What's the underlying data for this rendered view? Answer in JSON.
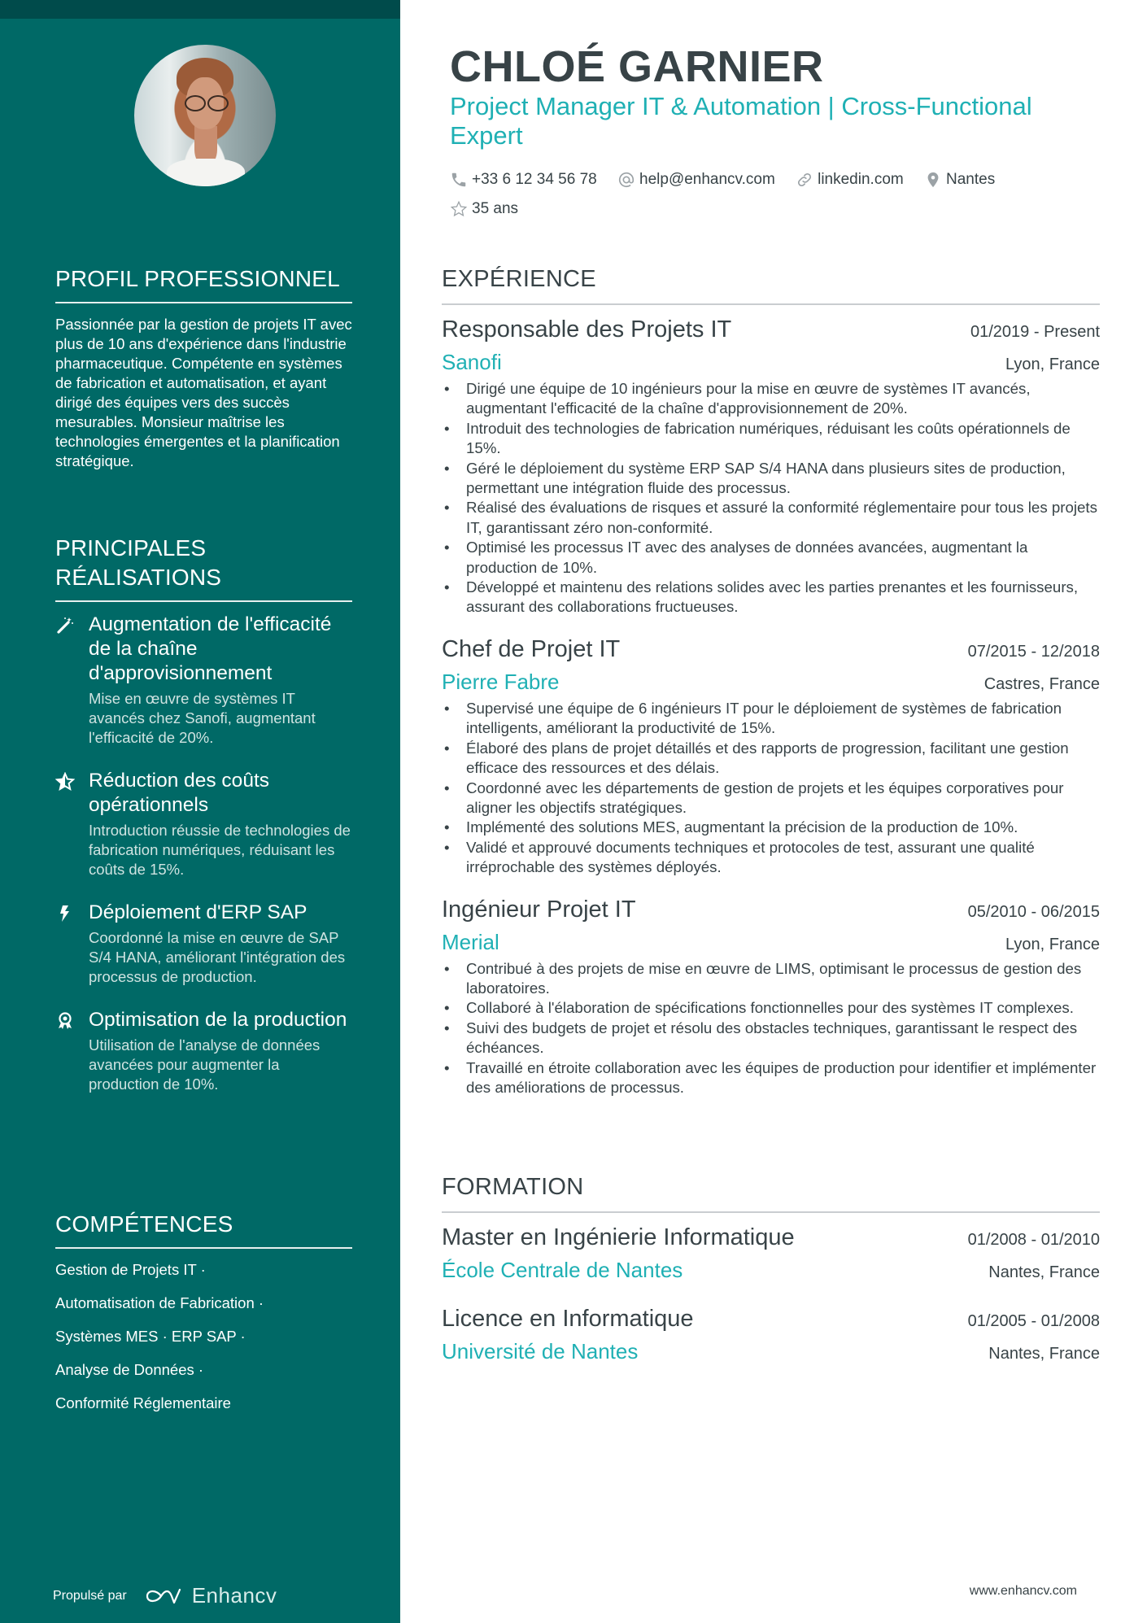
{
  "header": {
    "name": "CHLOÉ GARNIER",
    "tagline": "Project Manager IT & Automation | Cross-Functional Expert",
    "contacts": [
      {
        "icon": "phone-icon",
        "text": "+33 6 12 34 56 78"
      },
      {
        "icon": "at-icon",
        "text": "help@enhancv.com"
      },
      {
        "icon": "link-icon",
        "text": "linkedin.com"
      },
      {
        "icon": "location-pin-icon",
        "text": "Nantes"
      },
      {
        "icon": "star-outline-icon",
        "text": "35 ans"
      }
    ]
  },
  "sidebar": {
    "profile": {
      "title": "PROFIL PROFESSIONNEL",
      "text": "Passionnée par la gestion de projets IT avec plus de 10 ans d'expérience dans l'industrie pharmaceutique. Compétente en systèmes de fabrication et automatisation, et ayant dirigé des équipes vers des succès mesurables. Monsieur maîtrise les technologies émergentes et la planification stratégique."
    },
    "achievements": {
      "title": "PRINCIPALES RÉALISATIONS",
      "items": [
        {
          "icon": "magic-wand-icon",
          "title": "Augmentation de l'efficacité de la chaîne d'approvisionnement",
          "description": "Mise en œuvre de systèmes IT avancés chez Sanofi, augmentant l'efficacité de 20%."
        },
        {
          "icon": "star-half-icon",
          "title": "Réduction des coûts opérationnels",
          "description": "Introduction réussie de technologies de fabrication numériques, réduisant les coûts de 15%."
        },
        {
          "icon": "lightning-icon",
          "title": "Déploiement d'ERP SAP",
          "description": "Coordonné la mise en œuvre de SAP S/4 HANA, améliorant l'intégration des processus de production."
        },
        {
          "icon": "award-medal-icon",
          "title": "Optimisation de la production",
          "description": "Utilisation de l'analyse de données avancées pour augmenter la production de 10%."
        }
      ]
    },
    "skills": {
      "title": "COMPÉTENCES",
      "lines": [
        "Gestion de Projets IT ·",
        "Automatisation de Fabrication ·",
        "Systèmes MES · ERP SAP ·",
        "Analyse de Données ·",
        "Conformité Réglementaire"
      ]
    },
    "footer": {
      "powered_by": "Propulsé par",
      "brand": "Enhancv"
    }
  },
  "experience": {
    "title": "EXPÉRIENCE",
    "jobs": [
      {
        "title": "Responsable des Projets IT",
        "dates": "01/2019 - Present",
        "company": "Sanofi",
        "location": "Lyon, France",
        "bullets": [
          "Dirigé une équipe de 10 ingénieurs pour la mise en œuvre de systèmes IT avancés, augmentant l'efficacité de la chaîne d'approvisionnement de 20%.",
          "Introduit des technologies de fabrication numériques, réduisant les coûts opérationnels de 15%.",
          "Géré le déploiement du système ERP SAP S/4 HANA dans plusieurs sites de production, permettant une intégration fluide des processus.",
          "Réalisé des évaluations de risques et assuré la conformité réglementaire pour tous les projets IT, garantissant zéro non-conformité.",
          "Optimisé les processus IT avec des analyses de données avancées, augmentant la production de 10%.",
          "Développé et maintenu des relations solides avec les parties prenantes et les fournisseurs, assurant des collaborations fructueuses."
        ]
      },
      {
        "title": "Chef de Projet IT",
        "dates": "07/2015 - 12/2018",
        "company": "Pierre Fabre",
        "location": "Castres, France",
        "bullets": [
          "Supervisé une équipe de 6 ingénieurs IT pour le déploiement de systèmes de fabrication intelligents, améliorant la productivité de 15%.",
          "Élaboré des plans de projet détaillés et des rapports de progression, facilitant une gestion efficace des ressources et des délais.",
          "Coordonné avec les départements de gestion de projets et les équipes corporatives pour aligner les objectifs stratégiques.",
          "Implémenté des solutions MES, augmentant la précision de la production de 10%.",
          "Validé et approuvé documents techniques et protocoles de test, assurant une qualité irréprochable des systèmes déployés."
        ]
      },
      {
        "title": "Ingénieur Projet IT",
        "dates": "05/2010 - 06/2015",
        "company": "Merial",
        "location": "Lyon, France",
        "bullets": [
          "Contribué à des projets de mise en œuvre de LIMS, optimisant le processus de gestion des laboratoires.",
          "Collaboré à l'élaboration de spécifications fonctionnelles pour des systèmes IT complexes.",
          "Suivi des budgets de projet et résolu des obstacles techniques, garantissant le respect des échéances.",
          "Travaillé en étroite collaboration avec les équipes de production pour identifier et implémenter des améliorations de processus."
        ]
      }
    ]
  },
  "education": {
    "title": "FORMATION",
    "items": [
      {
        "degree": "Master en Ingénierie Informatique",
        "dates": "01/2008 - 01/2010",
        "school": "École Centrale de Nantes",
        "location": "Nantes, France"
      },
      {
        "degree": "Licence en Informatique",
        "dates": "01/2005 - 01/2008",
        "school": "Université de Nantes",
        "location": "Nantes, France"
      }
    ]
  },
  "footer": {
    "website": "www.enhancv.com"
  },
  "colors": {
    "sidebar": "#006966",
    "sidebar_top": "#004b4b",
    "accent": "#1fb0b4",
    "text": "#384347"
  }
}
